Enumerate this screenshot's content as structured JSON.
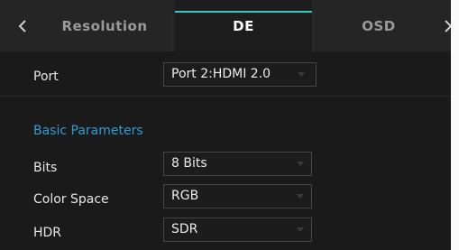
{
  "tabs": [
    {
      "label": "Resolution",
      "active": false
    },
    {
      "label": "DE",
      "active": true
    },
    {
      "label": "OSD",
      "active": false
    }
  ],
  "nav": {
    "prev_icon": "chevron-left-icon",
    "next_icon": "chevron-right-icon"
  },
  "port": {
    "label": "Port",
    "value": "Port 2:HDMI 2.0"
  },
  "section": {
    "heading": "Basic Parameters"
  },
  "fields": [
    {
      "label": "Bits",
      "value": "8 Bits"
    },
    {
      "label": "Color Space",
      "value": "RGB"
    },
    {
      "label": "HDR",
      "value": "SDR"
    }
  ],
  "colors": {
    "accent": "#34c7bd",
    "section_heading": "#2d9dd6",
    "panel_bg": "#1a1a1a",
    "tab_bar_bg": "#252525"
  }
}
